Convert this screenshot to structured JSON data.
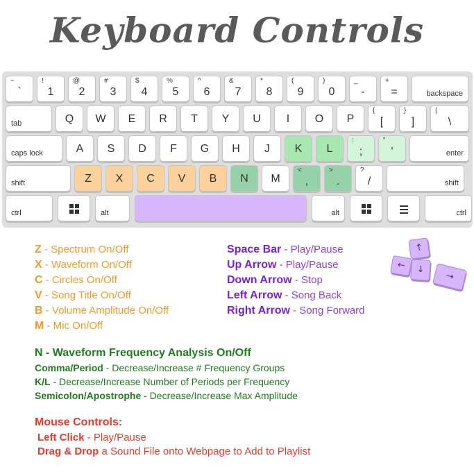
{
  "title": "Keyboard Controls",
  "keyboard": {
    "row1": [
      {
        "top": "~",
        "main": "`"
      },
      {
        "top": "!",
        "main": "1"
      },
      {
        "top": "@",
        "main": "2"
      },
      {
        "top": "#",
        "main": "3"
      },
      {
        "top": "$",
        "main": "4"
      },
      {
        "top": "%",
        "main": "5"
      },
      {
        "top": "^",
        "main": "6"
      },
      {
        "top": "&",
        "main": "7"
      },
      {
        "top": "*",
        "main": "8"
      },
      {
        "top": "(",
        "main": "9"
      },
      {
        "top": ")",
        "main": "0"
      },
      {
        "top": "_",
        "main": "-"
      },
      {
        "top": "+",
        "main": "="
      },
      {
        "wr": "backspace"
      }
    ],
    "row2": [
      {
        "wl": "tab"
      },
      {
        "main": "Q"
      },
      {
        "main": "W"
      },
      {
        "main": "E"
      },
      {
        "main": "R"
      },
      {
        "main": "T"
      },
      {
        "main": "Y"
      },
      {
        "main": "U"
      },
      {
        "main": "I"
      },
      {
        "main": "O"
      },
      {
        "main": "P"
      },
      {
        "top": "{",
        "main": "["
      },
      {
        "top": "}",
        "main": "]"
      },
      {
        "top": "|",
        "main": "\\"
      }
    ],
    "row3": [
      {
        "wl": "caps lock"
      },
      {
        "main": "A"
      },
      {
        "main": "S"
      },
      {
        "main": "D"
      },
      {
        "main": "F"
      },
      {
        "main": "G"
      },
      {
        "main": "H"
      },
      {
        "main": "J"
      },
      {
        "main": "K"
      },
      {
        "main": "L"
      },
      {
        "top": ":",
        "main": ";"
      },
      {
        "top": "\"",
        "main": "'"
      },
      {
        "wr": "enter"
      }
    ],
    "row4": [
      {
        "wl": "shift"
      },
      {
        "main": "Z"
      },
      {
        "main": "X"
      },
      {
        "main": "C"
      },
      {
        "main": "V"
      },
      {
        "main": "B"
      },
      {
        "main": "N"
      },
      {
        "main": "M"
      },
      {
        "top": "<",
        "main": ","
      },
      {
        "top": ">",
        "main": "."
      },
      {
        "top": "?",
        "main": "/"
      },
      {
        "wr": "shift"
      }
    ],
    "row5": [
      {
        "wl": "ctrl"
      },
      {
        "icon": "windows-icon"
      },
      {
        "wl": "alt"
      },
      {
        "space": true
      },
      {
        "wr": "alt"
      },
      {
        "icon": "windows-icon"
      },
      {
        "icon": "menu-icon"
      },
      {
        "wr": "ctrl"
      }
    ]
  },
  "colors": {
    "orange": "#fdd19c",
    "green_light": "#a8e8b0",
    "green_dark": "#96d2a8",
    "green_pale": "#d4f5da",
    "purple": "#d8b6fb"
  },
  "visual_controls": [
    {
      "key": "Z",
      "desc": " - Spectrum On/Off"
    },
    {
      "key": "X",
      "desc": " - Waveform On/Off"
    },
    {
      "key": "C",
      "desc": " - Circles On/Off"
    },
    {
      "key": "V",
      "desc": " - Song Title On/Off"
    },
    {
      "key": "B",
      "desc": " - Volume Amplitude On/Off"
    },
    {
      "key": "M",
      "desc": " - Mic On/Off"
    }
  ],
  "playback_controls": [
    {
      "key": "Space Bar",
      "desc": " - Play/Pause"
    },
    {
      "key": "Up Arrow",
      "desc": " - Play/Pause"
    },
    {
      "key": "Down Arrow",
      "desc": " - Stop"
    },
    {
      "key": "Left Arrow",
      "desc": " - Song Back"
    },
    {
      "key": "Right Arrow",
      "desc": " - Song Forward"
    }
  ],
  "frequency": {
    "heading": "N - Waveform Frequency Analysis On/Off",
    "items": [
      {
        "key": "Comma/Period",
        "desc": " - Decrease/Increase # Frequency Groups"
      },
      {
        "key": "K/L",
        "desc": " - Decrease/Increase Number of Periods per Frequency"
      },
      {
        "key": "Semicolon/Apostrophe",
        "desc": " - Decrease/Increase Max Amplitude"
      }
    ]
  },
  "mouse": {
    "heading": "Mouse Controls:",
    "items": [
      {
        "key": "Left Click",
        "desc": " - Play/Pause"
      },
      {
        "key": "Drag & Drop",
        "desc": " a Sound File onto Webpage to Add to Playlist"
      }
    ]
  },
  "arrow_keys": {
    "up": "↑",
    "down": "↓",
    "left": "←",
    "right": "→"
  }
}
